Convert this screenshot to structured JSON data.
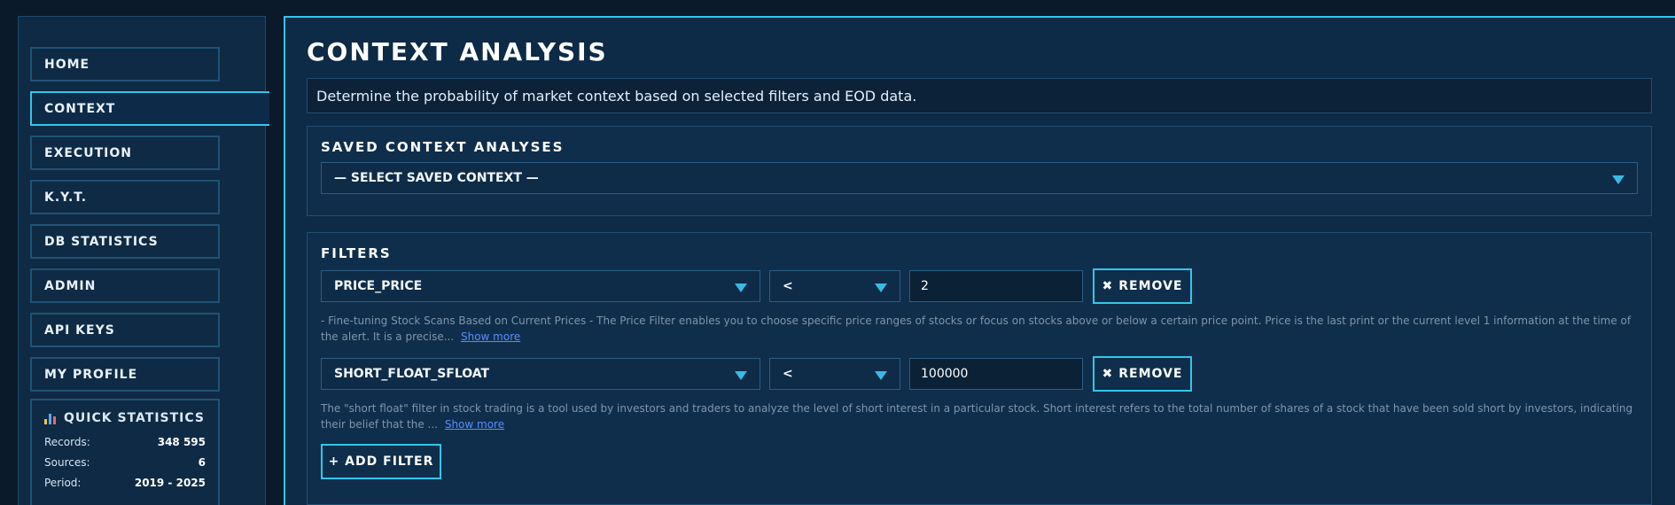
{
  "sidebar": {
    "items": [
      {
        "label": "HOME"
      },
      {
        "label": "CONTEXT",
        "active": true
      },
      {
        "label": "EXECUTION"
      },
      {
        "label": "K.Y.T."
      },
      {
        "label": "DB STATISTICS"
      },
      {
        "label": "ADMIN"
      },
      {
        "label": "API KEYS"
      },
      {
        "label": "MY PROFILE"
      }
    ],
    "stats": {
      "title": "QUICK STATISTICS",
      "icon": "bar-chart-icon",
      "rows": [
        {
          "label": "Records:",
          "value": "348 595"
        },
        {
          "label": "Sources:",
          "value": "6"
        },
        {
          "label": "Period:",
          "value": "2019 - 2025"
        }
      ]
    }
  },
  "main": {
    "title": "CONTEXT ANALYSIS",
    "description": "Determine the probability of market context based on selected filters and EOD data.",
    "saved": {
      "title": "SAVED CONTEXT ANALYSES",
      "select_value": "— SELECT SAVED CONTEXT —"
    },
    "filters": {
      "title": "FILTERS",
      "items": [
        {
          "field": "PRICE_PRICE",
          "operator": "<",
          "value": "2",
          "remove_label": "REMOVE",
          "description": "- Fine-tuning Stock Scans Based on Current Prices - The Price Filter enables you to choose specific price ranges of stocks or focus on stocks above or below a certain price point. Price is the last print or the current level 1 information at the time of the alert. It is a precise...",
          "show_more": "Show more"
        },
        {
          "field": "SHORT_FLOAT_SFLOAT",
          "operator": "<",
          "value": "100000",
          "remove_label": "REMOVE",
          "description": "The \"short float\" filter in stock trading is a tool used by investors and traders to analyze the level of short interest in a particular stock. Short interest refers to the total number of shares of a stock that have been sold short by investors, indicating their belief that the ...",
          "show_more": "Show more"
        }
      ],
      "add_label": "+  ADD FILTER"
    }
  },
  "colors": {
    "accent": "#33c6ea",
    "background": "#0a1a2a",
    "panel": "#0f2e4b"
  }
}
